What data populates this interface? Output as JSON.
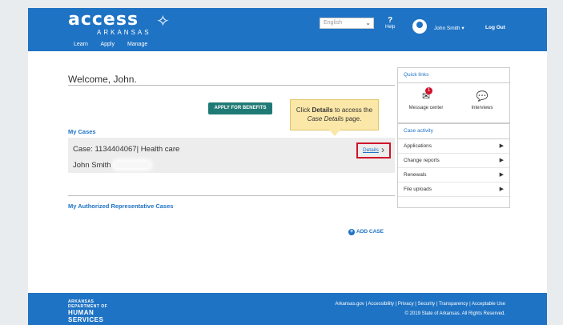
{
  "header": {
    "logo_text": "access",
    "logo_symbol": "✧",
    "logo_subtitle": "ARKANSAS",
    "nav": [
      "Learn",
      "Apply",
      "Manage"
    ],
    "language_value": "English",
    "help_label": "Help",
    "help_symbol": "?",
    "user_name": "John Smith ▾",
    "logout_label": "Log Out"
  },
  "main": {
    "welcome": "Welcome, John.",
    "apply_button": "APPLY FOR BENEFITS",
    "tooltip_line1_pre": "Click ",
    "tooltip_line1_bold": "Details",
    "tooltip_line1_post": " to access the",
    "tooltip_line2_italic": "Case Details",
    "tooltip_line2_post": " page.",
    "my_cases_title": "My Cases",
    "case_title": "Case: 1134404067| Health care",
    "case_name": "John Smith",
    "details_link": "Details",
    "details_chevron": "›",
    "auth_cases_title": "My Authorized Representative Cases",
    "add_case_label": "ADD CASE"
  },
  "quick_links": {
    "title": "Quick links",
    "items": [
      {
        "label": "Message center",
        "icon": "envelope-icon",
        "badge": "1"
      },
      {
        "label": "Interviews",
        "icon": "chat-icon"
      }
    ]
  },
  "case_activity": {
    "title": "Case activity",
    "items": [
      "Applications",
      "Change reports",
      "Renewals",
      "File uploads"
    ]
  },
  "footer": {
    "dhs_line1": "ARKANSAS",
    "dhs_line2": "DEPARTMENT OF",
    "dhs_line3": "HUMAN",
    "dhs_line4": "SERVICES",
    "links": "Arkansas.gov | Accessibility | Privacy | Security | Transparency | Acceptable Use",
    "copyright": "© 2019 State of Arkansas. All Rights Reserved."
  },
  "colors": {
    "brand_blue": "#1f73c4",
    "apply_button": "#1f7a75",
    "tooltip_bg": "#fbe7a7",
    "highlight_red": "#d0112b"
  }
}
